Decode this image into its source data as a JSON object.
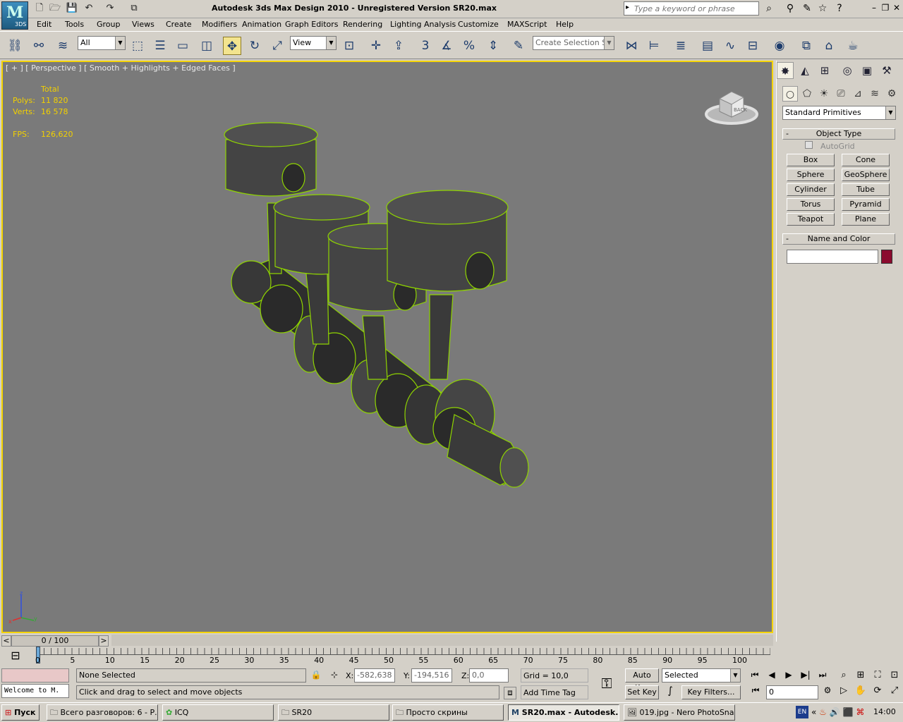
{
  "window": {
    "title": "Autodesk 3ds Max Design 2010  - Unregistered Version     SR20.max",
    "logo_text": "3DS",
    "search_placeholder": "Type a keyword or phrase"
  },
  "menu": [
    "Edit",
    "Tools",
    "Group",
    "Views",
    "Create",
    "Modifiers",
    "Animation",
    "Graph Editors",
    "Rendering",
    "Lighting Analysis",
    "Customize",
    "MAXScript",
    "Help"
  ],
  "toolbar": {
    "selection_filter": "All",
    "reference_coord": "View",
    "named_selection_placeholder": "Create Selection Se",
    "snap_label": "3"
  },
  "viewport": {
    "label": "[ + ] [ Perspective ] [ Smooth + Highlights + Edged Faces ]",
    "stats_header": "Total",
    "polys_label": "Polys:",
    "polys_value": "11 820",
    "verts_label": "Verts:",
    "verts_value": "16 578",
    "fps_label": "FPS:",
    "fps_value": "126,620",
    "viewcube_text": "BACK",
    "mesh_color": "#8fd400",
    "background": "#7a7a7a",
    "axis": {
      "x": "x",
      "y": "y",
      "z": "z"
    }
  },
  "command_panel": {
    "dropdown": "Standard Primitives",
    "object_type_title": "Object Type",
    "autogrid_label": "AutoGrid",
    "autogrid_checked": false,
    "buttons": [
      "Box",
      "Cone",
      "Sphere",
      "GeoSphere",
      "Cylinder",
      "Tube",
      "Torus",
      "Pyramid",
      "Teapot",
      "Plane"
    ],
    "name_color_title": "Name and Color",
    "name_value": "",
    "color_swatch": "#8b0a2e"
  },
  "timeline": {
    "frame_display": "0 / 100",
    "ticks": [
      "0",
      "5",
      "10",
      "15",
      "20",
      "25",
      "30",
      "35",
      "40",
      "45",
      "50",
      "55",
      "60",
      "65",
      "70",
      "75",
      "80",
      "85",
      "90",
      "95",
      "100"
    ]
  },
  "status": {
    "maxscript_listener": "Welcome to M.",
    "selection": "None Selected",
    "prompt": "Click and drag to select and move objects",
    "x_label": "X:",
    "x_value": "-582,638",
    "y_label": "Y:",
    "y_value": "-194,516",
    "z_label": "Z:",
    "z_value": "0,0",
    "grid": "Grid = 10,0",
    "add_time_tag": "Add Time Tag",
    "auto_key": "Auto Key",
    "set_key": "Set Key",
    "key_mode": "Selected",
    "key_filters": "Key Filters...",
    "current_frame": "0"
  },
  "taskbar": {
    "start": "Пуск",
    "tasks": [
      "Всего разговоров: 6 - Р...",
      "ICQ",
      "SR20",
      "Просто скрины",
      "SR20.max - Autodesk...",
      "019.jpg - Nero PhotoSna..."
    ],
    "lang": "EN",
    "clock": "14:00"
  }
}
